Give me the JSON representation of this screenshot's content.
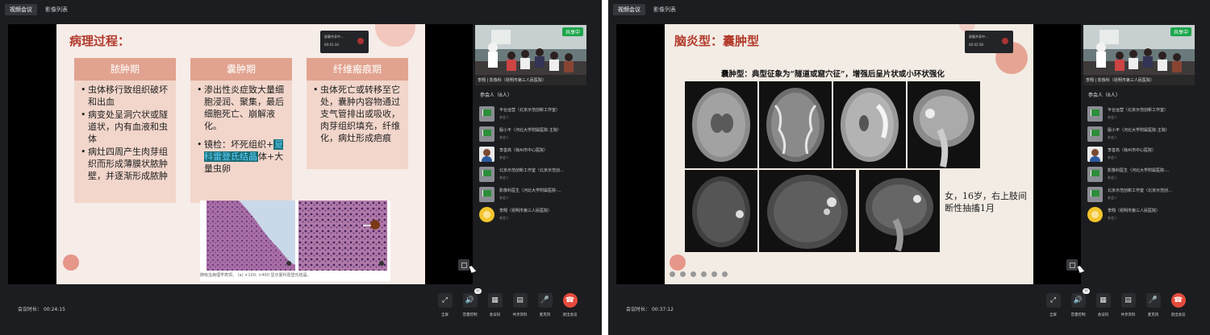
{
  "tabs": [
    "视频会议",
    "影像列表"
  ],
  "screens": [
    {
      "slide": {
        "title": "病理过程：",
        "columns": [
          {
            "heading": "脓肿期",
            "bullets": [
              "虫体移行致组织破坏和出血",
              "病变处呈洞穴状或隧道状，内有血液和虫体",
              "病灶四周产生肉芽组织而形成薄膜状脓肿壁，并逐渐形成脓肿"
            ]
          },
          {
            "heading": "囊肿期",
            "bullet": "渗出性炎症致大量细胞浸润、聚集，最后细胞死亡、崩解液化。",
            "mirror": "镜检：坏死组织+",
            "mirror_hl": "夏科雷登氏结晶",
            "mirror_tail": "体+大量虫卵"
          },
          {
            "heading": "纤维瘢痕期",
            "bullets": [
              "虫体死亡或转移至它处，囊肿内容物通过支气管排出或吸收，肉芽组织填充，纤维化，病灶形成疤痕"
            ]
          }
        ],
        "micro_caption": "肺吸虫病理学表现。 (a) ×100; ×400 显示夏科雷登氏结晶。"
      },
      "recording": {
        "line1": "屏幕共享中...",
        "line2": "00:01:34"
      },
      "timer_label": "会议时长：",
      "timer_value": "00:24:15"
    },
    {
      "slide": {
        "title": "脑炎型：囊肿型",
        "subtitle": "囊肿型：典型征象为“隧道或窟穴征”，增强后呈片状或小环状强化",
        "caption": "女，16岁，右上肢间断性抽搐1月"
      },
      "recording": {
        "line1": "屏幕共享中...",
        "line2": "00:02:58"
      },
      "timer_label": "会议时长：",
      "timer_value": "00:37:12"
    }
  ],
  "video": {
    "badge": "共享中",
    "name": "李翔 | 影像科（昆明市第三人民医院）"
  },
  "participants": {
    "title": "参会人（6人）",
    "role": "参会人",
    "items": [
      {
        "name": "平台运营（北京示范创新工作室）",
        "avatar": "flag"
      },
      {
        "name": "殷小平（河北大学附属医院-主院）",
        "avatar": "flag"
      },
      {
        "name": "李善高（徐州市中心医院）",
        "avatar": "photo"
      },
      {
        "name": "北京示范创新工作室（北京示范创...",
        "avatar": "flag"
      },
      {
        "name": "影像科医生（河北大学附属医院-...",
        "avatar": "flag"
      },
      {
        "name": "李翔（昆明市第三人民医院）",
        "avatar": "cartoon"
      }
    ]
  },
  "controls": [
    {
      "label": "全屏",
      "icon": "⤢",
      "name": "fullscreen"
    },
    {
      "label": "音量控制",
      "icon": "🔊",
      "name": "volume"
    },
    {
      "label": "会议码",
      "icon": "▦",
      "name": "meeting-code"
    },
    {
      "label": "共享资料",
      "icon": "▤",
      "name": "share-materials"
    },
    {
      "label": "麦克风",
      "icon": "🎤",
      "name": "microphone"
    },
    {
      "label": "退出会议",
      "icon": "☎",
      "name": "exit-meeting"
    }
  ],
  "volume_badge": "12"
}
